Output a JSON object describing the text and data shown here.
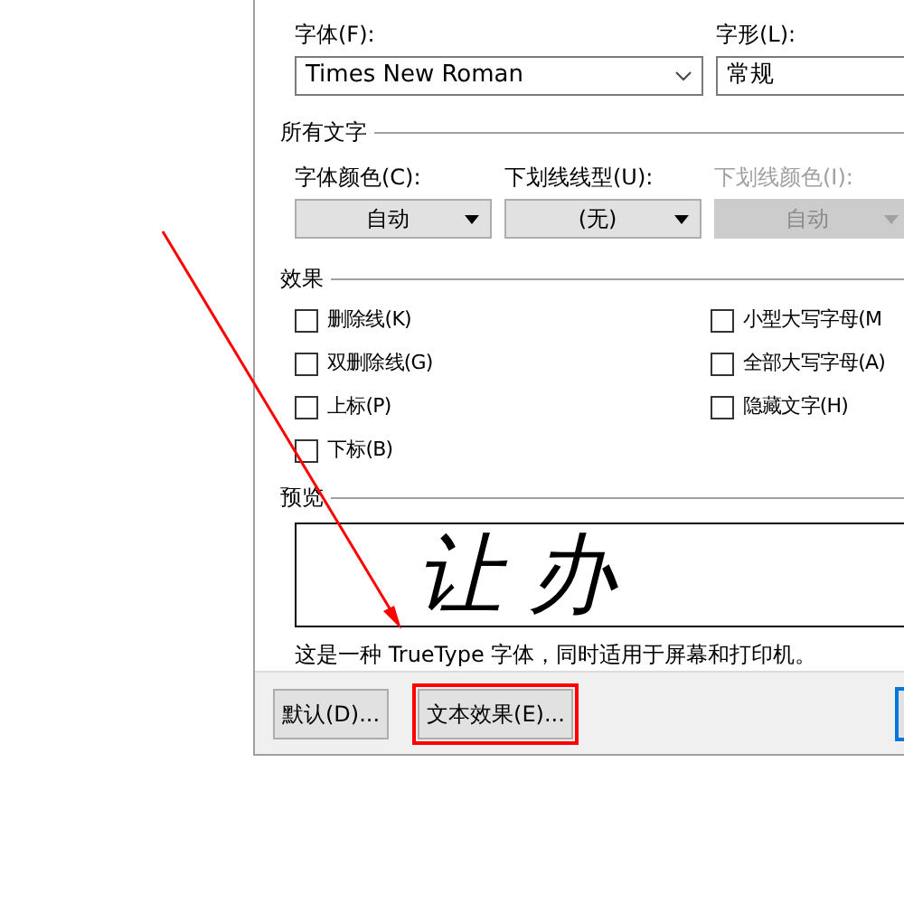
{
  "font_section": {
    "font_label": "字体(F):",
    "font_value": "Times New Roman",
    "style_label": "字形(L):",
    "style_value": "常规"
  },
  "all_text": {
    "title": "所有文字",
    "dropdowns": [
      {
        "label": "字体颜色(C):",
        "value": "自动",
        "disabled": false
      },
      {
        "label": "下划线线型(U):",
        "value": "(无)",
        "disabled": false
      },
      {
        "label": "下划线颜色(I):",
        "value": "自动",
        "disabled": true
      }
    ]
  },
  "effects": {
    "title": "效果",
    "columns": [
      [
        {
          "label": "删除线(K)",
          "checked": false
        },
        {
          "label": "双删除线(G)",
          "checked": false
        },
        {
          "label": "上标(P)",
          "checked": false
        },
        {
          "label": "下标(B)",
          "checked": false
        }
      ],
      [
        {
          "label": "小型大写字母(M",
          "checked": false
        },
        {
          "label": "全部大写字母(A)",
          "checked": false
        },
        {
          "label": "隐藏文字(H)",
          "checked": false
        }
      ]
    ]
  },
  "preview": {
    "title": "预览",
    "sample": "让办",
    "description": "这是一种 TrueType 字体，同时适用于屏幕和打印机。"
  },
  "buttons": [
    {
      "label": "默认(D)...",
      "highlighted": false
    },
    {
      "label": "文本效果(E)...",
      "highlighted": true
    }
  ]
}
